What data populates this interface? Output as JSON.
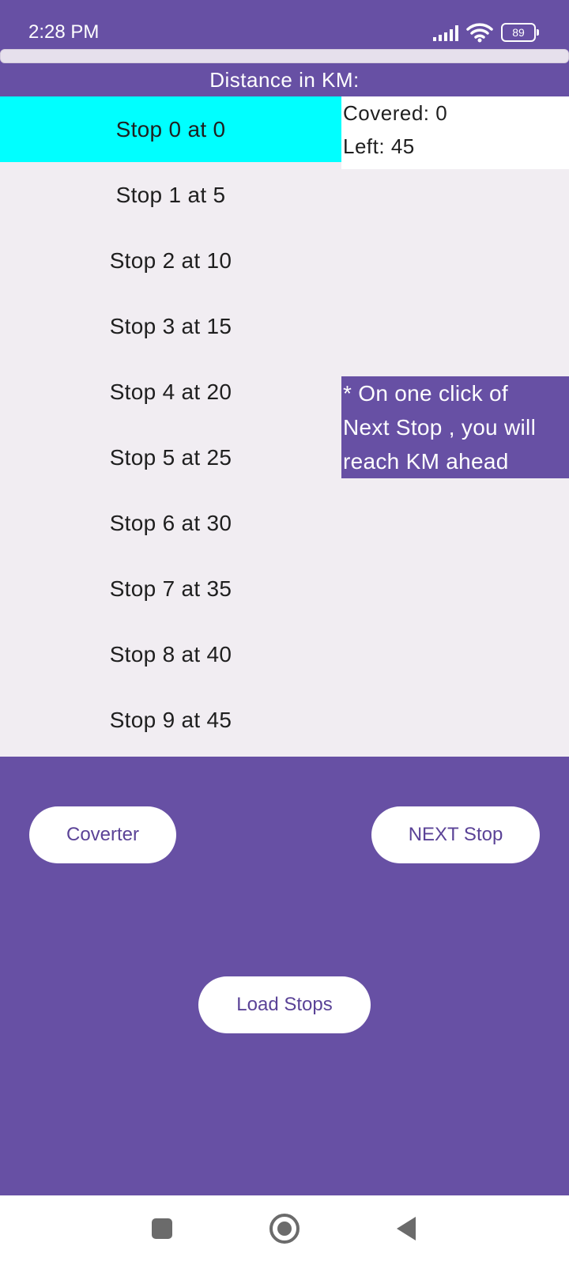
{
  "status_bar": {
    "time": "2:28 PM",
    "battery": "89"
  },
  "header": {
    "title": "Distance in KM:"
  },
  "stops": [
    {
      "label": "Stop 0 at 0"
    },
    {
      "label": "Stop 1 at 5"
    },
    {
      "label": "Stop 2 at 10"
    },
    {
      "label": "Stop 3 at 15"
    },
    {
      "label": "Stop 4 at 20"
    },
    {
      "label": "Stop 5 at 25"
    },
    {
      "label": "Stop 6 at 30"
    },
    {
      "label": "Stop 7 at 35"
    },
    {
      "label": "Stop 8 at 40"
    },
    {
      "label": "Stop 9 at 45"
    }
  ],
  "progress": {
    "covered": "Covered: 0",
    "left": "Left: 45"
  },
  "hint": {
    "line1": "* On one click of",
    "line2": "Next Stop , you will",
    "line3": "reach KM  ahead"
  },
  "buttons": {
    "converter": "Coverter",
    "next_stop": "NEXT Stop",
    "load_stops": "Load Stops"
  },
  "colors": {
    "primary": "#6750a4",
    "selected_stop": "#00ffff",
    "list_background": "#f1edf2"
  }
}
